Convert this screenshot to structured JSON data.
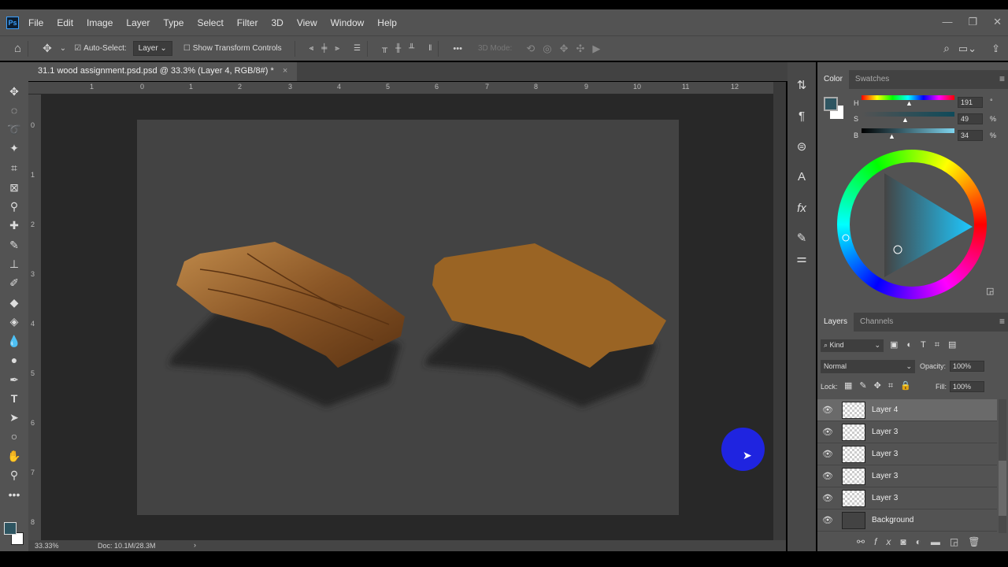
{
  "app": {
    "logo": "Ps"
  },
  "menu": [
    "File",
    "Edit",
    "Image",
    "Layer",
    "Type",
    "Select",
    "Filter",
    "3D",
    "View",
    "Window",
    "Help"
  ],
  "options": {
    "auto_select_label": "Auto-Select:",
    "auto_select_value": "Layer",
    "show_transform_label": "Show Transform Controls",
    "mode_3d_label": "3D Mode:",
    "more": "•••"
  },
  "document": {
    "tab_title": "31.1 wood assignment.psd.psd @ 33.3% (Layer 4, RGB/8#) *",
    "close": "×"
  },
  "ruler": {
    "top": [
      "1",
      "0",
      "1",
      "2",
      "3",
      "4",
      "5",
      "6",
      "7",
      "8",
      "9",
      "10",
      "11",
      "12"
    ],
    "left": [
      "0",
      "1",
      "2",
      "3",
      "4",
      "5",
      "6",
      "7",
      "8"
    ]
  },
  "status": {
    "zoom": "33.33%",
    "doc": "Doc: 10.1M/28.3M",
    "arrow": "›"
  },
  "color_panel": {
    "tabs": [
      "Color",
      "Swatches"
    ],
    "h_label": "H",
    "s_label": "S",
    "b_label": "B",
    "h": "191",
    "s": "49",
    "b": "34",
    "h_unit": "°",
    "s_unit": "%",
    "b_unit": "%",
    "foreground": "#2e5561",
    "background": "#ffffff"
  },
  "layers_panel": {
    "tabs": [
      "Layers",
      "Channels"
    ],
    "filter": "Kind",
    "blend_mode": "Normal",
    "opacity_label": "Opacity:",
    "opacity": "100%",
    "lock_label": "Lock:",
    "fill_label": "Fill:",
    "fill": "100%",
    "layers": [
      {
        "name": "Layer 4",
        "active": true
      },
      {
        "name": "Layer 3"
      },
      {
        "name": "Layer 3"
      },
      {
        "name": "Layer 3"
      },
      {
        "name": "Layer 3"
      },
      {
        "name": "Background"
      }
    ]
  }
}
